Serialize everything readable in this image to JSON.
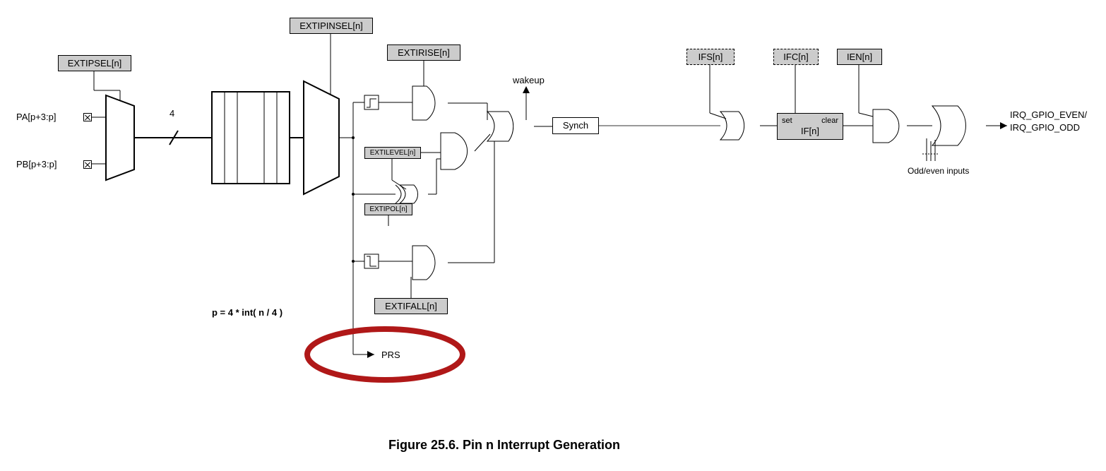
{
  "labels": {
    "extipsel": "EXTIPSEL[n]",
    "extipinsel": "EXTIPINSEL[n]",
    "extirise": "EXTIRISE[n]",
    "extilevel": "EXTILEVEL[n]",
    "extipol": "EXTIPOL[n]",
    "extifall": "EXTIFALL[n]",
    "ifs": "IFS[n]",
    "ifc": "IFC[n]",
    "ien": "IEN[n]",
    "ifn": "IF[n]",
    "set": "set",
    "clear": "clear",
    "synch": "Synch",
    "wakeup": "wakeup",
    "pa": "PA[p+3:p]",
    "pb": "PB[p+3:p]",
    "bus4": "4",
    "formula": "p = 4 * int( n / 4 )",
    "prs": "PRS",
    "oddeven": "Odd/even inputs",
    "out1": "IRQ_GPIO_EVEN/",
    "out2": "IRQ_GPIO_ODD",
    "caption": "Figure 25.6.  Pin n Interrupt Generation"
  }
}
